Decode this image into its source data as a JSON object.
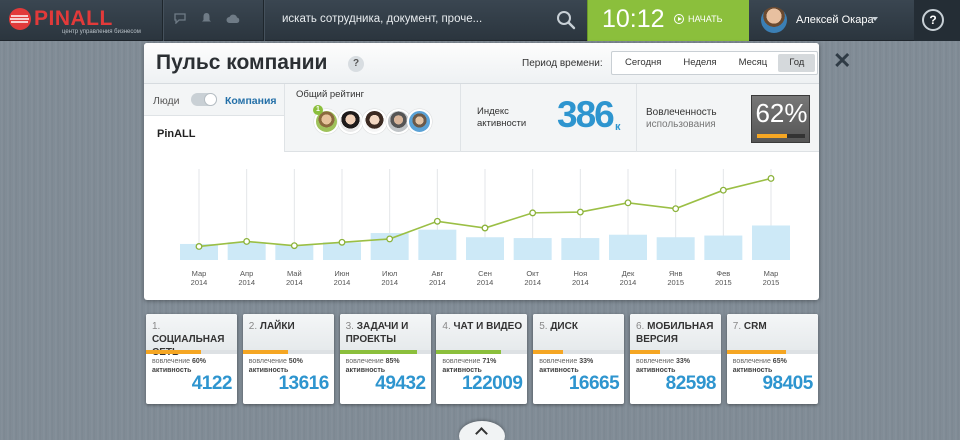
{
  "header": {
    "logo_text": "PINALL",
    "logo_subtitle": "центр управления бизнесом",
    "search_placeholder": "искать сотрудника, документ, проче...",
    "clock": "10:12",
    "start_label": "НАЧАТЬ",
    "user_name": "Алексей Окара",
    "help_label": "?"
  },
  "panel": {
    "title": "Пульс компании",
    "help_label": "?",
    "period_label": "Период времени:",
    "periods": [
      "Сегодня",
      "Неделя",
      "Месяц",
      "Год"
    ],
    "active_period": "Год",
    "toggle_left": "Люди",
    "toggle_right": "Компания",
    "company_name": "PinALL",
    "rating_label": "Общий рейтинг",
    "rating_rank": "1",
    "index_label": "Индекс активности",
    "index_value": "386",
    "index_unit": "к",
    "engagement_label": "Вовлеченность",
    "engagement_sub": "использования",
    "engagement_value": "62%",
    "engagement_fraction": 0.62
  },
  "chart_data": {
    "type": "line",
    "categories": [
      [
        "Мар",
        "2014"
      ],
      [
        "Апр",
        "2014"
      ],
      [
        "Май",
        "2014"
      ],
      [
        "Июн",
        "2014"
      ],
      [
        "Июл",
        "2014"
      ],
      [
        "Авг",
        "2014"
      ],
      [
        "Сен",
        "2014"
      ],
      [
        "Окт",
        "2014"
      ],
      [
        "Ноя",
        "2014"
      ],
      [
        "Дек",
        "2014"
      ],
      [
        "Янв",
        "2015"
      ],
      [
        "Фев",
        "2015"
      ],
      [
        "Мар",
        "2015"
      ]
    ],
    "series": [
      {
        "type": "line",
        "values": [
          3,
          9,
          4,
          8,
          12,
          33,
          25,
          43,
          44,
          55,
          48,
          70,
          84
        ]
      },
      {
        "type": "bar",
        "values": [
          6,
          8,
          5,
          8,
          19,
          23,
          14,
          13,
          13,
          17,
          14,
          16,
          28
        ]
      }
    ],
    "ylim": [
      0,
      100
    ],
    "grid": "vertical"
  },
  "cards": [
    {
      "num": "1.",
      "title": "СОЦИАЛЬНАЯ СЕТЬ",
      "engagement_label": "вовлечение",
      "engagement": "60%",
      "activity_label": "активность",
      "value": "4122",
      "fraction": 0.6,
      "color": "#f5a623"
    },
    {
      "num": "2.",
      "title": "ЛАЙКИ",
      "engagement_label": "вовлечение",
      "engagement": "50%",
      "activity_label": "активность",
      "value": "13616",
      "fraction": 0.5,
      "color": "#f5a623"
    },
    {
      "num": "3.",
      "title": "ЗАДАЧИ И ПРОЕКТЫ",
      "engagement_label": "вовлечение",
      "engagement": "85%",
      "activity_label": "активность",
      "value": "49432",
      "fraction": 0.85,
      "color": "#8bbf3c"
    },
    {
      "num": "4.",
      "title": "ЧАТ И ВИДЕО",
      "engagement_label": "вовлечение",
      "engagement": "71%",
      "activity_label": "активность",
      "value": "122009",
      "fraction": 0.71,
      "color": "#8bbf3c"
    },
    {
      "num": "5.",
      "title": "ДИСК",
      "engagement_label": "вовлечение",
      "engagement": "33%",
      "activity_label": "активность",
      "value": "16665",
      "fraction": 0.33,
      "color": "#f5a623"
    },
    {
      "num": "6.",
      "title": "МОБИЛЬНАЯ ВЕРСИЯ",
      "engagement_label": "вовлечение",
      "engagement": "33%",
      "activity_label": "активность",
      "value": "82598",
      "fraction": 0.33,
      "color": "#f5a623"
    },
    {
      "num": "7.",
      "title": "CRM",
      "engagement_label": "вовлечение",
      "engagement": "65%",
      "activity_label": "активность",
      "value": "98405",
      "fraction": 0.65,
      "color": "#f5a623"
    }
  ]
}
